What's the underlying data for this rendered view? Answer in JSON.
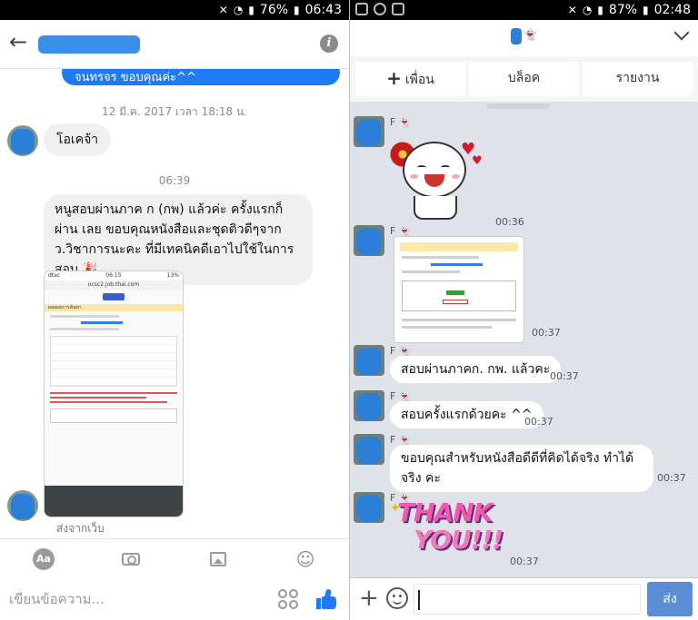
{
  "left": {
    "status": {
      "battery": "76%",
      "time": "06:43"
    },
    "header": {
      "back_icon": "back-arrow-icon",
      "info_icon": "info-icon"
    },
    "messages": {
      "partial_sent": "จนทรจร ขอบคุณค่ะ^^",
      "timestamp_1": "12 มี.ค. 2017 เวลา 18:18 น.",
      "reply_1": "โอเคจ้า",
      "timestamp_2": "06:39",
      "long_message": "หนูสอบผ่านภาค ก (กพ) แล้วค่ะ ครั้งแรกก็ผ่าน เลย ขอบคุณหนังสือและชุดติวดีๆจาก ว.วิชาการนะคะ ที่มีเทคนิคดีเอาไปใช้ในการ สอบ 🎉",
      "attachment_caption": "ส่งจากเว็บ"
    },
    "screenshot_thumb": {
      "carrier": "dtac",
      "time": "06:15",
      "battery": "13%",
      "url": "ocsc2.job.thai.com",
      "banner": "ผลสอบการค้นหา"
    },
    "compose": {
      "placeholder": "เขียนข้อความ...",
      "aa": "Aa"
    }
  },
  "right": {
    "status": {
      "battery": "87%",
      "time": "02:48"
    },
    "actions": {
      "add_friend": "เพื่อน",
      "block": "บล็อค",
      "report": "รายงาน"
    },
    "sender_initial": "F",
    "messages": {
      "time_1": "00:36",
      "time_2": "00:37",
      "text_1": "สอบผ่านภาคก. กพ. แล้วคะ",
      "time_3": "00:37",
      "text_2": "สอบครั้งแรกด้วยคะ ^^",
      "time_4": "00:37",
      "text_3": "ขอบคุณสำหรับหนังสือดีดีที่คิดได้จริง ทำได้จริง คะ",
      "time_5": "00:37",
      "sticker_line1": "THANK",
      "sticker_line2": "YOU!!!",
      "time_6": "00:37"
    },
    "compose": {
      "send": "ส่ง"
    }
  },
  "colors": {
    "messenger_blue": "#1e7bf5",
    "line_bg": "#dfe2e8",
    "send_button": "#5a8dd6"
  }
}
